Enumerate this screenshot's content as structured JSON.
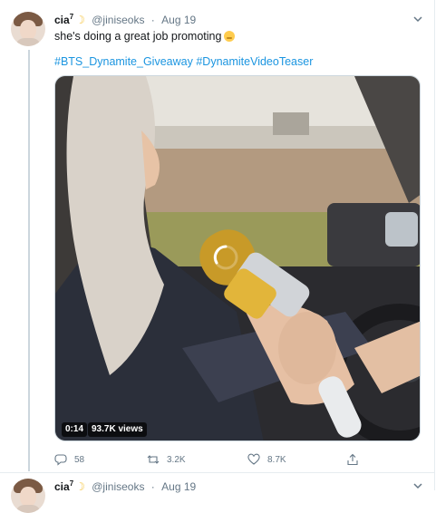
{
  "tweet": {
    "display_name": "cia",
    "name_superscript": "7",
    "name_emoji": "crescent-moon-icon",
    "handle": "@jiniseoks",
    "date_separator": "·",
    "date": "Aug 19",
    "text": "she's doing a great job promoting",
    "text_emoji": "shushing-face-emoji",
    "hashtags": [
      "#BTS_Dynamite_Giveaway",
      "#DynamiteVideoTeaser"
    ],
    "video": {
      "elapsed": "0:14",
      "views": "93.7K views",
      "loading_icon": "spinner-icon"
    },
    "actions": {
      "replies": "58",
      "retweets": "3.2K",
      "likes": "8.7K"
    }
  },
  "next_tweet": {
    "display_name": "cia",
    "name_superscript": "7",
    "handle": "@jiniseoks",
    "date_separator": "·",
    "date": "Aug 19"
  },
  "colors": {
    "link_blue": "#1b95e0",
    "secondary_text": "#657786",
    "divider": "#e6ecf0"
  }
}
